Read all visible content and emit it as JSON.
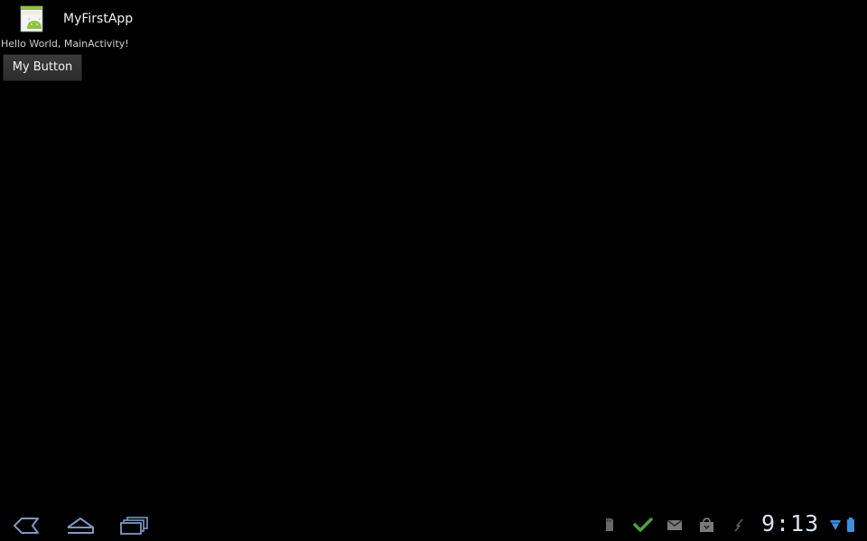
{
  "action_bar": {
    "app_title": "MyFirstApp",
    "app_icon": "android-app-icon"
  },
  "content": {
    "hello_text": "Hello World, MainActivity!",
    "button_label": "My Button"
  },
  "system_bar": {
    "nav": [
      "back-icon",
      "home-icon",
      "recent-apps-icon"
    ],
    "status_icons": [
      "sd-card-icon",
      "checkmark-icon",
      "gmail-icon",
      "market-bag-icon",
      "usb-debug-icon",
      "wifi-icon",
      "battery-icon"
    ],
    "clock": "9:13"
  },
  "colors": {
    "background": "#000000",
    "accent_blue": "#3f8fdc",
    "check_green": "#4aa33a"
  }
}
